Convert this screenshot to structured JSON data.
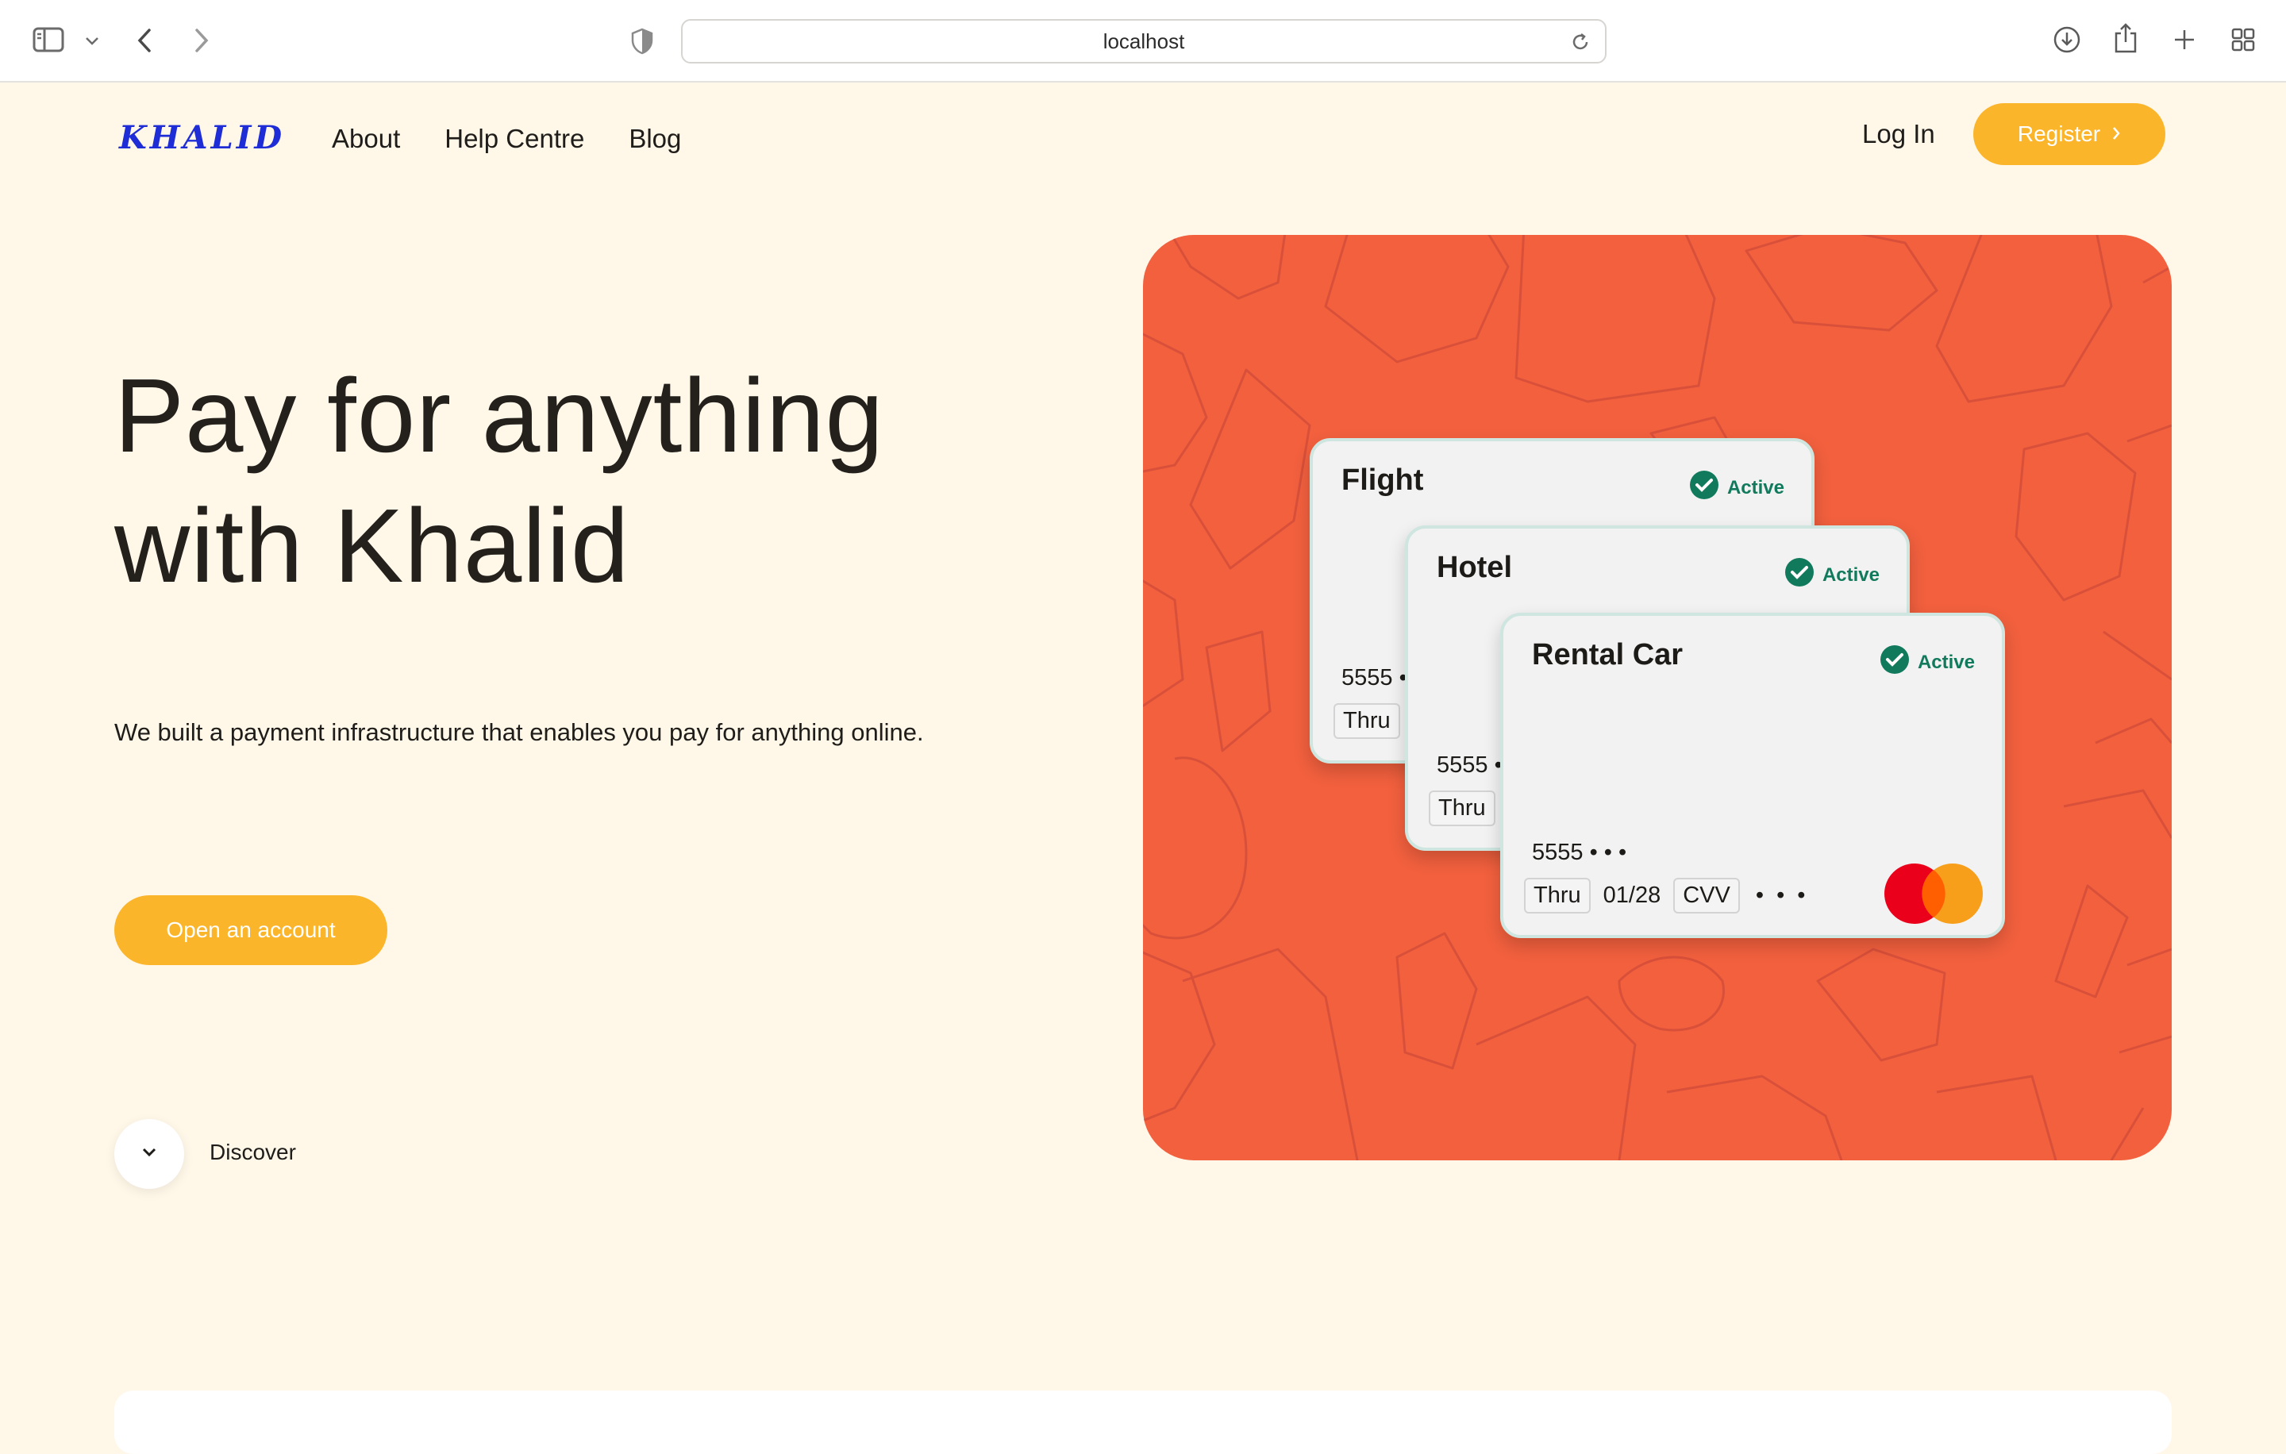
{
  "browser": {
    "url": "localhost",
    "icons": [
      "sidebar-toggle-icon",
      "chevron-down-icon",
      "back-arrow-icon",
      "forward-arrow-icon",
      "privacy-shield-icon",
      "reload-icon",
      "download-icon",
      "share-icon",
      "new-tab-icon",
      "tab-overview-icon"
    ]
  },
  "header": {
    "logo": "KHALID",
    "nav": [
      "About",
      "Help Centre",
      "Blog"
    ],
    "login_label": "Log In",
    "register_label": "Register"
  },
  "hero": {
    "title_line1": "Pay for anything",
    "title_line2": "with Khalid",
    "subtitle": "We built a payment infrastructure that enables you pay for anything online.",
    "cta_label": "Open an account",
    "discover_label": "Discover"
  },
  "cards": [
    {
      "title": "Flight",
      "status": "Active",
      "number": "5555 •",
      "expiry_label": "Thru"
    },
    {
      "title": "Hotel",
      "status": "Active",
      "number": "5555 •",
      "expiry_label": "Thru"
    },
    {
      "title": "Rental Car",
      "status": "Active",
      "number": "5555 • • •",
      "expiry_label": "Thru",
      "expiry": "01/28",
      "cvv_label": "CVV",
      "cvv_mask": "• • •"
    }
  ],
  "colors": {
    "background": "#fff7e8",
    "accent": "#fbb52b",
    "logo": "#1f2dd6",
    "panel": "#f2603e",
    "active": "#127a5c"
  }
}
